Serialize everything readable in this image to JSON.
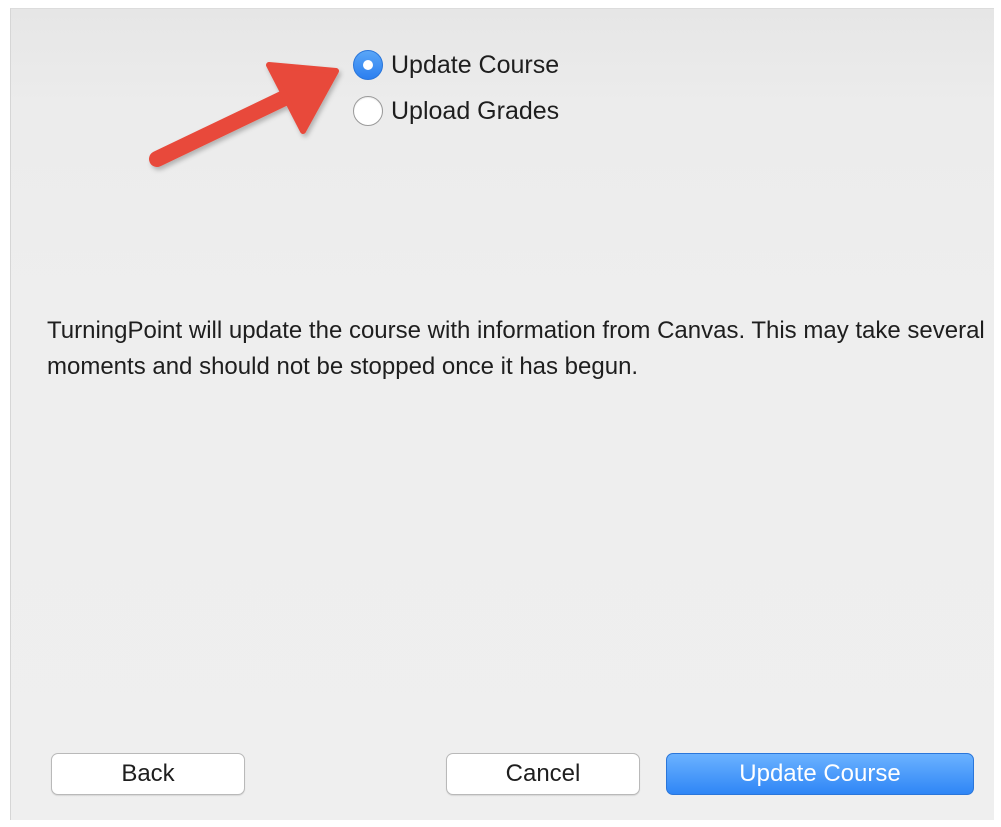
{
  "options": [
    {
      "label": "Update Course",
      "selected": true
    },
    {
      "label": "Upload Grades",
      "selected": false
    }
  ],
  "message": "TurningPoint will update the course with information from Canvas. This may take several moments and should not be stopped once it has begun.",
  "buttons": {
    "back": "Back",
    "cancel": "Cancel",
    "update": "Update Course"
  },
  "colors": {
    "accent": "#2f86f6",
    "annotation_arrow": "#e8493a"
  },
  "icons": {
    "annotation": "arrow-pointer-icon"
  }
}
